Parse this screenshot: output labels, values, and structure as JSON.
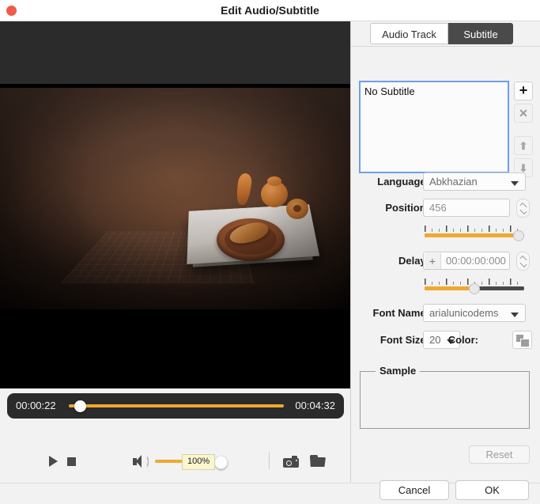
{
  "window": {
    "title": "Edit Audio/Subtitle",
    "close_icon": "close-traffic-light",
    "accent_color": "#f0a830",
    "close_color": "#f05b4a"
  },
  "tabs": [
    {
      "id": "audio-track",
      "label": "Audio Track",
      "selected": false
    },
    {
      "id": "subtitle",
      "label": "Subtitle",
      "selected": true
    }
  ],
  "subtitle_panel": {
    "list": {
      "items": [
        "No Subtitle"
      ],
      "selected_index": 0
    },
    "list_buttons": [
      {
        "id": "add",
        "icon": "plus-icon",
        "glyph": "➕",
        "label": "+",
        "enabled": true
      },
      {
        "id": "remove",
        "icon": "close-x-icon",
        "glyph": "✖",
        "label": "✖",
        "enabled": false
      },
      {
        "id": "move-up",
        "icon": "arrow-up-icon",
        "glyph": "⬆",
        "label": "▲",
        "enabled": false
      },
      {
        "id": "move-down",
        "icon": "arrow-down-icon",
        "glyph": "⬇",
        "label": "▼",
        "enabled": false
      }
    ],
    "language": {
      "label": "Language:",
      "value": "Abkhazian"
    },
    "position": {
      "label": "Position:",
      "value": "456",
      "slider_percent": 97
    },
    "delay": {
      "label": "Delay:",
      "sign": "+",
      "value": "00:00:00:000",
      "slider_percent": 50
    },
    "font_name": {
      "label": "Font Name:",
      "value": "arialunicodems"
    },
    "font_size": {
      "label": "Font Size:",
      "value": "20"
    },
    "color": {
      "label": "Color:",
      "swatch_icon": "color-swatch-icon"
    },
    "sample": {
      "label": "Sample",
      "text": ""
    },
    "reset": {
      "label": "Reset",
      "enabled": false
    }
  },
  "player": {
    "current_time": "00:00:22",
    "total_time": "00:04:32",
    "seek_percent": 5,
    "volume_percent": 100,
    "volume_tooltip": "100%",
    "buttons": [
      {
        "id": "play",
        "icon": "play-icon"
      },
      {
        "id": "stop",
        "icon": "stop-icon"
      },
      {
        "id": "volume",
        "icon": "speaker-icon"
      },
      {
        "id": "snapshot",
        "icon": "camera-icon"
      },
      {
        "id": "open-folder",
        "icon": "folder-icon"
      }
    ]
  },
  "footer": {
    "cancel_label": "Cancel",
    "ok_label": "OK"
  }
}
